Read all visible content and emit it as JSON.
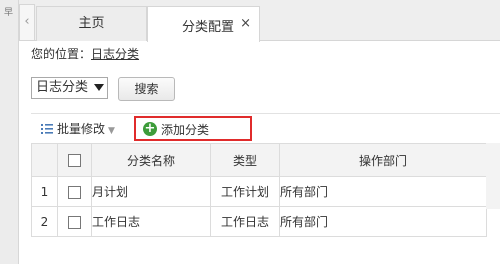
{
  "left_strip": {
    "pin_label": "早"
  },
  "tabs": {
    "prev_arrow": "‹",
    "home": "主页",
    "active": "分类配置",
    "close": "×"
  },
  "breadcrumb": {
    "prefix": "您的位置：",
    "link": "日志分类"
  },
  "filter": {
    "select_value": "日志分类",
    "search_button": "搜索"
  },
  "toolbar": {
    "batch_label": "批量修改",
    "add_label": "添加分类"
  },
  "table": {
    "headers": [
      "分类名称",
      "类型",
      "操作部门"
    ],
    "rows": [
      {
        "index": "1",
        "name": "月计划",
        "type": "工作计划",
        "dept": "所有部门"
      },
      {
        "index": "2",
        "name": "工作日志",
        "type": "工作日志",
        "dept": "所有部门"
      }
    ]
  },
  "colors": {
    "accent_red": "#e02b2b",
    "add_icon_green": "#3d9c3a"
  }
}
